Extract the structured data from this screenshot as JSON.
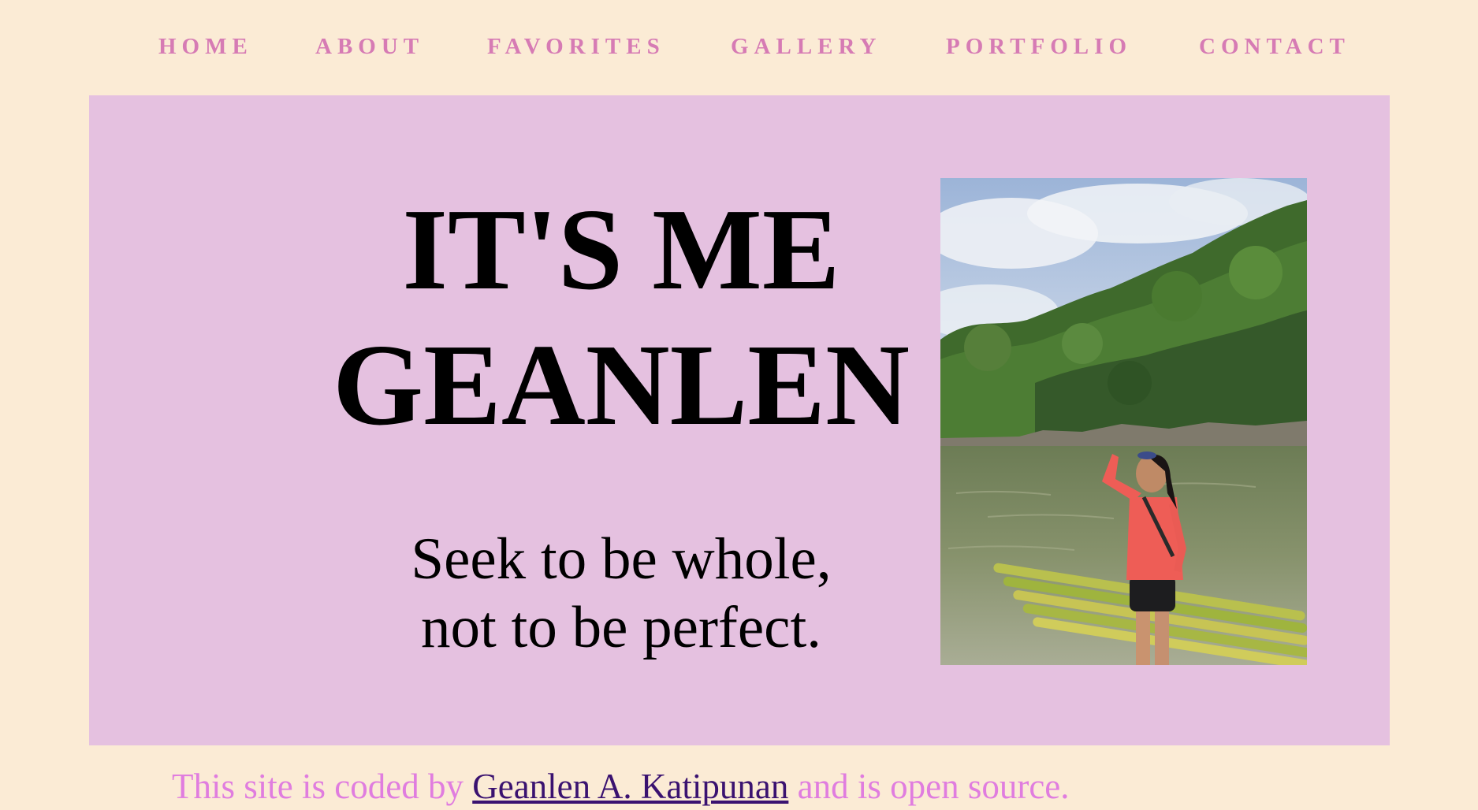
{
  "nav": {
    "items": [
      {
        "label": "HOME"
      },
      {
        "label": "ABOUT"
      },
      {
        "label": "FAVORITES"
      },
      {
        "label": "GALLERY"
      },
      {
        "label": "PORTFOLIO"
      },
      {
        "label": "CONTACT"
      }
    ]
  },
  "hero": {
    "title_line1": "IT'S ME",
    "title_line2": "GEANLEN",
    "tagline_line1": "Seek to be whole,",
    "tagline_line2": "not to be perfect."
  },
  "footer": {
    "prefix": "This site is coded by ",
    "author_link": "Geanlen A. Katipunan",
    "suffix": " and is open source."
  },
  "colors": {
    "page_background": "#fbebd5",
    "hero_background": "#e5c1e0",
    "nav_text": "#d67bb4",
    "footer_text": "#e07ddf",
    "footer_link": "#3a1270"
  }
}
